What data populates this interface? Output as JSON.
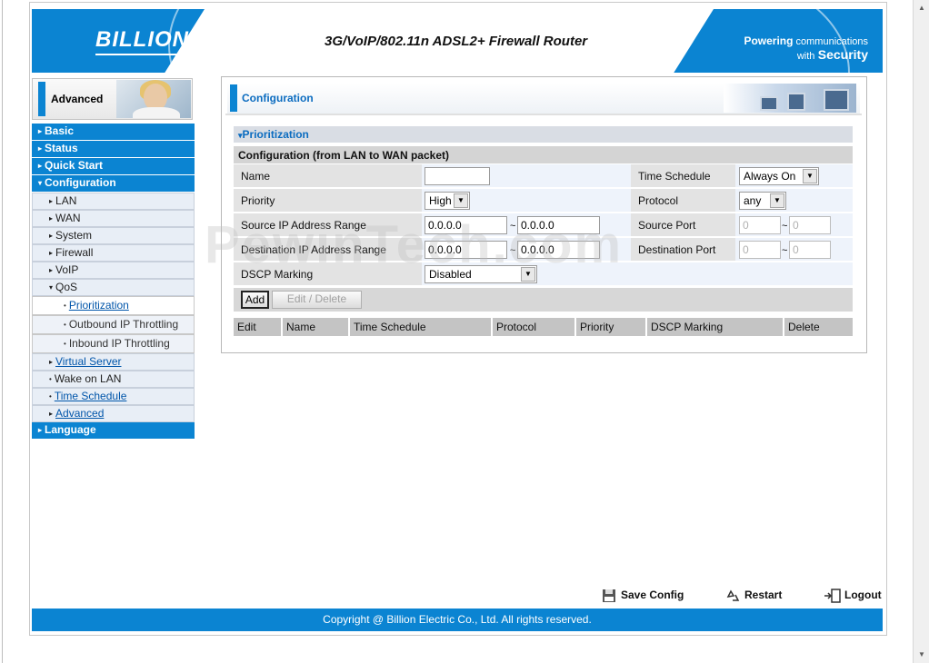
{
  "banner": {
    "logo": "BILLION",
    "title": "3G/VoIP/802.11n ADSL2+ Firewall Router",
    "tagline_1": "Powering",
    "tagline_1b": "communications",
    "tagline_2a": "with",
    "tagline_2b": "Security"
  },
  "sidebar": {
    "mode_label": "Advanced",
    "items": [
      {
        "label": "Basic"
      },
      {
        "label": "Status"
      },
      {
        "label": "Quick Start"
      },
      {
        "label": "Configuration"
      },
      {
        "label": "LAN"
      },
      {
        "label": "WAN"
      },
      {
        "label": "System"
      },
      {
        "label": "Firewall"
      },
      {
        "label": "VoIP"
      },
      {
        "label": "QoS"
      },
      {
        "label": "Prioritization"
      },
      {
        "label": "Outbound IP Throttling"
      },
      {
        "label": "Inbound IP Throttling"
      },
      {
        "label": "Virtual Server"
      },
      {
        "label": "Wake on LAN"
      },
      {
        "label": "Time Schedule"
      },
      {
        "label": "Advanced"
      },
      {
        "label": "Language"
      }
    ]
  },
  "page": {
    "title": "Configuration",
    "section": "Prioritization",
    "subsection": "Configuration (from LAN to WAN packet)"
  },
  "form": {
    "name_label": "Name",
    "name_value": "",
    "time_schedule_label": "Time Schedule",
    "time_schedule_value": "Always On",
    "priority_label": "Priority",
    "priority_value": "High",
    "protocol_label": "Protocol",
    "protocol_value": "any",
    "src_ip_label": "Source IP Address Range",
    "src_ip_from": "0.0.0.0",
    "src_ip_to": "0.0.0.0",
    "src_port_label": "Source Port",
    "src_port_from": "0",
    "src_port_to": "0",
    "dst_ip_label": "Destination IP Address Range",
    "dst_ip_from": "0.0.0.0",
    "dst_ip_to": "0.0.0.0",
    "dst_port_label": "Destination Port",
    "dst_port_from": "0",
    "dst_port_to": "0",
    "dscp_label": "DSCP Marking",
    "dscp_value": "Disabled",
    "tilde": "~",
    "add_label": "Add",
    "edit_delete_label": "Edit / Delete"
  },
  "table": {
    "columns": [
      "Edit",
      "Name",
      "Time Schedule",
      "Protocol",
      "Priority",
      "DSCP Marking",
      "Delete"
    ]
  },
  "watermark": "PewinTech.com",
  "footer": {
    "save_config": "Save Config",
    "restart": "Restart",
    "logout": "Logout",
    "copyright": "Copyright @ Billion Electric Co., Ltd. All rights reserved."
  },
  "colors": {
    "brand_blue": "#0b84d2",
    "link_blue": "#0055aa"
  },
  "icons": {
    "menu_arrow": "triangle-right",
    "expanded_arrow": "triangle-down",
    "dropdown": "triangle-down",
    "save": "floppy-disk",
    "restart": "recycle",
    "logout": "exit-door"
  }
}
